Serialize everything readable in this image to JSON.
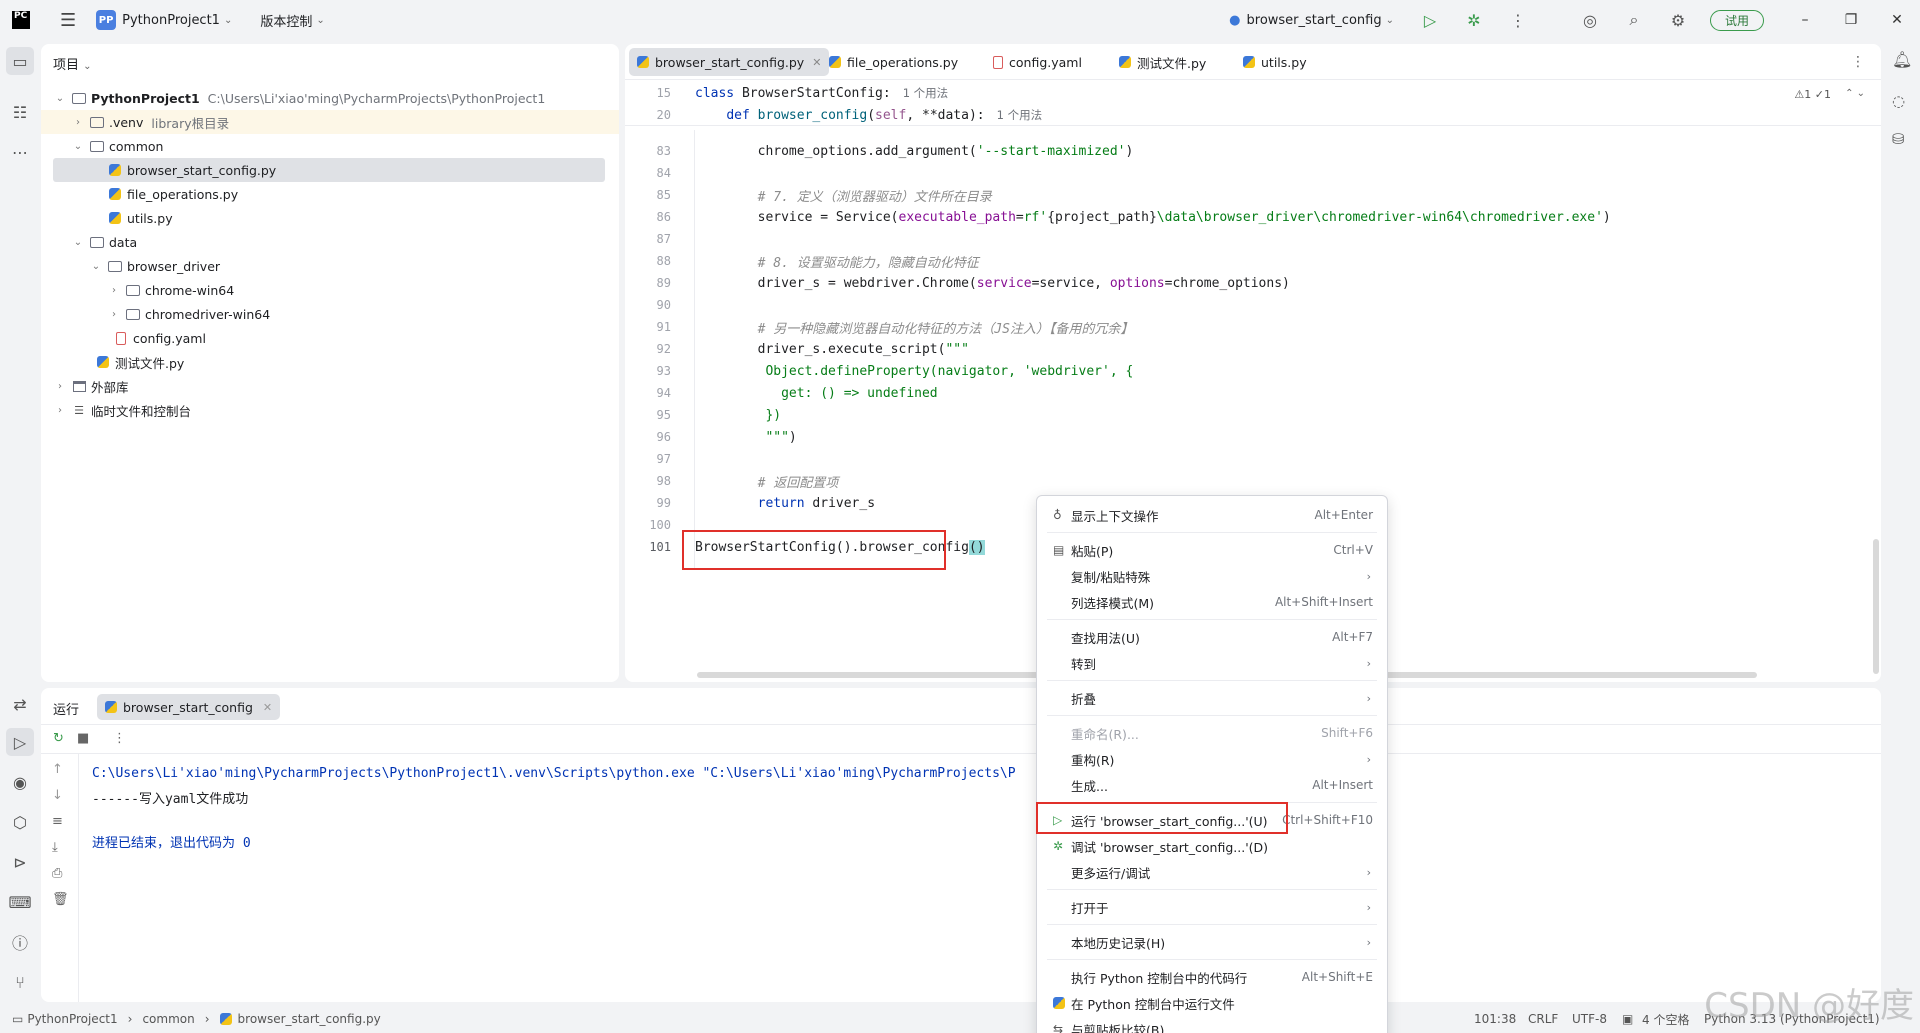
{
  "titlebar": {
    "project_name": "PythonProject1",
    "project_badge": "PP",
    "vcs_label": "版本控制",
    "run_config": "browser_start_config",
    "trial_label": "试用"
  },
  "project_panel": {
    "title": "项目",
    "tree": [
      {
        "label": "PythonProject1",
        "extra": "C:\\Users\\Li'xiao'ming\\PycharmProjects\\PythonProject1"
      },
      {
        "label": ".venv",
        "extra": "library根目录"
      },
      {
        "label": "common"
      },
      {
        "label": "browser_start_config.py"
      },
      {
        "label": "file_operations.py"
      },
      {
        "label": "utils.py"
      },
      {
        "label": "data"
      },
      {
        "label": "browser_driver"
      },
      {
        "label": "chrome-win64"
      },
      {
        "label": "chromedriver-win64"
      },
      {
        "label": "config.yaml"
      },
      {
        "label": "测试文件.py"
      },
      {
        "label": "外部库"
      },
      {
        "label": "临时文件和控制台"
      }
    ]
  },
  "editor": {
    "tabs": [
      "browser_start_config.py",
      "file_operations.py",
      "config.yaml",
      "测试文件.py",
      "utils.py"
    ],
    "inspection": "⚠1 ✓1",
    "sticky": [
      {
        "ln": "15",
        "code": "class BrowserStartConfig:",
        "hint": "1 个用法"
      },
      {
        "ln": "20",
        "code": "    def browser_config(self, **data):",
        "hint": "1 个用法"
      }
    ],
    "lines": [
      {
        "ln": "83",
        "code": "        chrome_options.add_argument('--start-maximized')"
      },
      {
        "ln": "84",
        "code": ""
      },
      {
        "ln": "85",
        "code": "        # 7. 定义（浏览器驱动）文件所在目录"
      },
      {
        "ln": "86",
        "code": "        service = Service(executable_path=rf'{project_path}\\data\\browser_driver\\chromedriver-win64\\chromedriver.exe')"
      },
      {
        "ln": "87",
        "code": ""
      },
      {
        "ln": "88",
        "code": "        # 8. 设置驱动能力，隐藏自动化特征"
      },
      {
        "ln": "89",
        "code": "        driver_s = webdriver.Chrome(service=service, options=chrome_options)"
      },
      {
        "ln": "90",
        "code": ""
      },
      {
        "ln": "91",
        "code": "        # 另一种隐藏浏览器自动化特征的方法（JS注入）【备用的冗余】"
      },
      {
        "ln": "92",
        "code": "        driver_s.execute_script(\"\"\""
      },
      {
        "ln": "93",
        "code": "         Object.defineProperty(navigator, 'webdriver', {"
      },
      {
        "ln": "94",
        "code": "           get: () => undefined"
      },
      {
        "ln": "95",
        "code": "         })"
      },
      {
        "ln": "96",
        "code": "         \"\"\")"
      },
      {
        "ln": "97",
        "code": ""
      },
      {
        "ln": "98",
        "code": "        # 返回配置项"
      },
      {
        "ln": "99",
        "code": "        return driver_s"
      },
      {
        "ln": "100",
        "code": ""
      },
      {
        "ln": "101",
        "code": "BrowserStartConfig().browser_config()"
      }
    ]
  },
  "run_panel": {
    "title": "运行",
    "tab": "browser_start_config",
    "console": [
      "C:\\Users\\Li'xiao'ming\\PycharmProjects\\PythonProject1\\.venv\\Scripts\\python.exe \"C:\\Users\\Li'xiao'ming\\PycharmProjects\\P",
      "------写入yaml文件成功",
      "",
      "进程已结束，退出代码为 0"
    ]
  },
  "context_menu": {
    "items": [
      {
        "label": "显示上下文操作",
        "shortcut": "Alt+Enter"
      },
      {
        "label": "粘贴(P)",
        "shortcut": "Ctrl+V"
      },
      {
        "label": "复制/粘贴特殊",
        "shortcut": ""
      },
      {
        "label": "列选择模式(M)",
        "shortcut": "Alt+Shift+Insert"
      },
      {
        "label": "查找用法(U)",
        "shortcut": "Alt+F7"
      },
      {
        "label": "转到",
        "shortcut": ""
      },
      {
        "label": "折叠",
        "shortcut": ""
      },
      {
        "label": "重命名(R)...",
        "shortcut": "Shift+F6"
      },
      {
        "label": "重构(R)",
        "shortcut": ""
      },
      {
        "label": "生成...",
        "shortcut": "Alt+Insert"
      },
      {
        "label": "运行 'browser_start_config...'(U)",
        "shortcut": "Ctrl+Shift+F10"
      },
      {
        "label": "调试 'browser_start_config...'(D)",
        "shortcut": ""
      },
      {
        "label": "更多运行/调试",
        "shortcut": ""
      },
      {
        "label": "打开于",
        "shortcut": ""
      },
      {
        "label": "本地历史记录(H)",
        "shortcut": ""
      },
      {
        "label": "执行 Python 控制台中的代码行",
        "shortcut": "Alt+Shift+E"
      },
      {
        "label": "在 Python 控制台中运行文件",
        "shortcut": ""
      },
      {
        "label": "与剪贴板比较(B)",
        "shortcut": ""
      }
    ]
  },
  "statusbar": {
    "breadcrumb": [
      "PythonProject1",
      "common",
      "browser_start_config.py"
    ],
    "position": "101:38",
    "line_sep": "CRLF",
    "encoding": "UTF-8",
    "indent": "4 个空格",
    "interpreter": "Python 3.13 (PythonProject1)"
  },
  "watermark": "CSDN @好度"
}
